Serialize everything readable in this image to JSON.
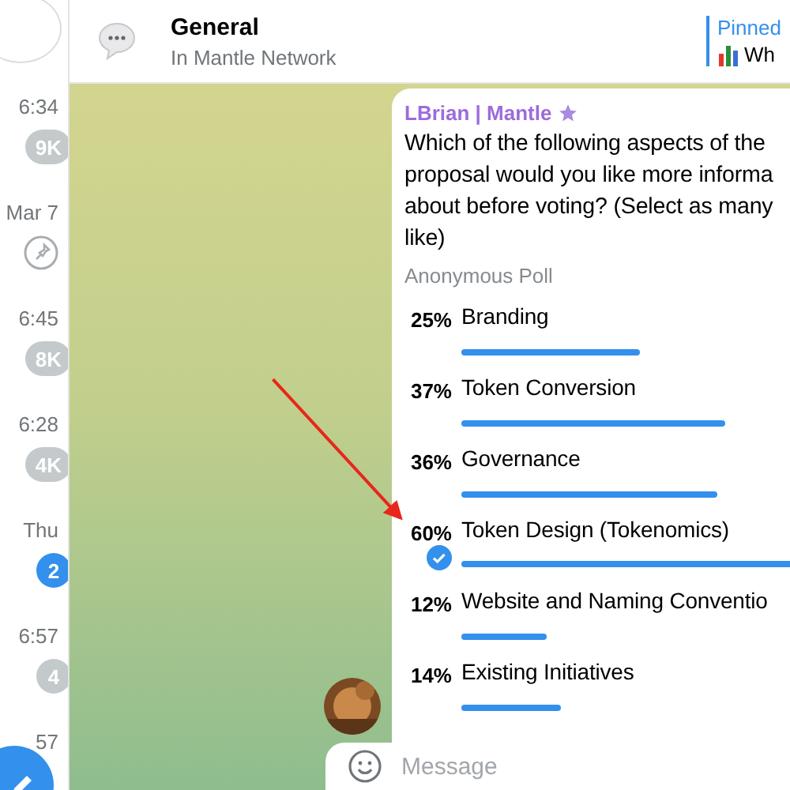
{
  "sidebar": {
    "items": [
      {
        "time": "6:34",
        "badge": "9K",
        "kind": "muted"
      },
      {
        "time": "Mar 7",
        "kind": "pin"
      },
      {
        "time": "6:45",
        "badge": "8K",
        "kind": "muted"
      },
      {
        "time": "6:28",
        "badge": "4K",
        "kind": "muted"
      },
      {
        "time": "Thu",
        "badge": "2",
        "kind": "unread"
      },
      {
        "time": "6:57",
        "badge": "4",
        "kind": "muted"
      },
      {
        "time": "57",
        "kind": "none"
      }
    ]
  },
  "header": {
    "title": "General",
    "subtitle": "In Mantle Network",
    "pinned": {
      "label": "Pinned",
      "text": "Wh"
    }
  },
  "message": {
    "author": "LBrian | Mantle",
    "question": [
      "Which of the following aspects of the",
      "proposal would you like more informa",
      "about before voting? (Select as many",
      "like)"
    ],
    "poll_type": "Anonymous Poll",
    "options": [
      {
        "percent": "25%",
        "label": "Branding",
        "selected": false
      },
      {
        "percent": "37%",
        "label": "Token Conversion",
        "selected": false
      },
      {
        "percent": "36%",
        "label": "Governance",
        "selected": false
      },
      {
        "percent": "60%",
        "label": "Token Design (Tokenomics)",
        "selected": true
      },
      {
        "percent": "12%",
        "label": "Website and Naming Conventio",
        "selected": false
      },
      {
        "percent": "14%",
        "label": "Existing Initiatives",
        "selected": false
      }
    ]
  },
  "composer": {
    "placeholder": "Message"
  }
}
